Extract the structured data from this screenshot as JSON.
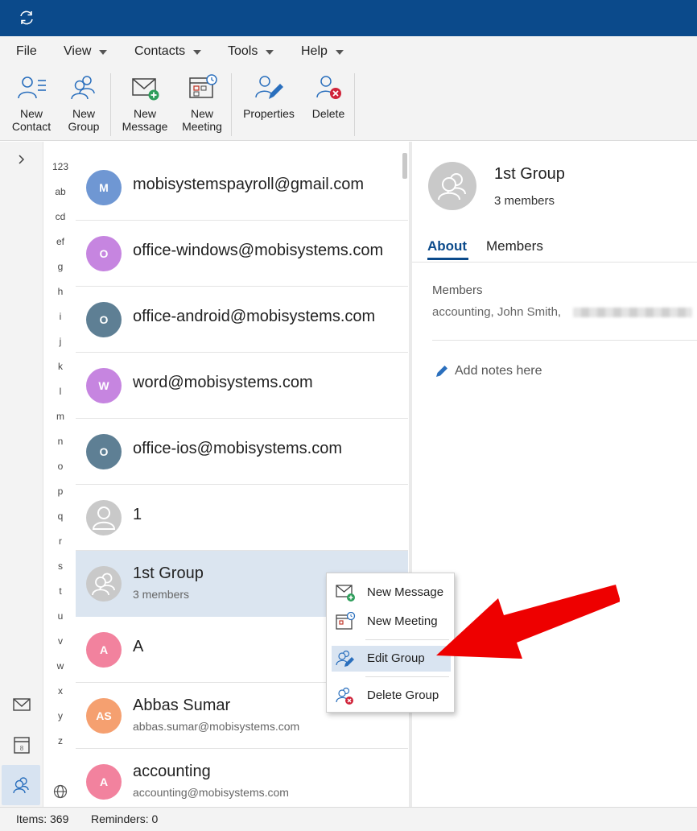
{
  "menu": {
    "file": "File",
    "view": "View",
    "contacts": "Contacts",
    "tools": "Tools",
    "help": "Help"
  },
  "ribbon": {
    "new_contact": [
      "New",
      "Contact"
    ],
    "new_group": [
      "New",
      "Group"
    ],
    "new_message": [
      "New",
      "Message"
    ],
    "new_meeting": [
      "New",
      "Meeting"
    ],
    "properties": "Properties",
    "delete": "Delete"
  },
  "alphabet": [
    "123",
    "ab",
    "cd",
    "ef",
    "g",
    "h",
    "i",
    "j",
    "k",
    "l",
    "m",
    "n",
    "o",
    "p",
    "q",
    "r",
    "s",
    "t",
    "u",
    "v",
    "w",
    "x",
    "y",
    "z"
  ],
  "contacts": [
    {
      "initials": "M",
      "name": "mobisystemspayroll@gmail.com",
      "sub": "",
      "color": "#6f97d3"
    },
    {
      "initials": "O",
      "name": "office-windows@mobisystems.com",
      "sub": "",
      "color": "#c685e0"
    },
    {
      "initials": "O",
      "name": "office-android@mobisystems.com",
      "sub": "",
      "color": "#5e7f94"
    },
    {
      "initials": "W",
      "name": "word@mobisystems.com",
      "sub": "",
      "color": "#c685e0"
    },
    {
      "initials": "O",
      "name": "office-ios@mobisystems.com",
      "sub": "",
      "color": "#5e7f94"
    },
    {
      "initials": "",
      "name": "1",
      "sub": "",
      "color": "#c9c9c9"
    },
    {
      "initials": "",
      "name": "1st Group",
      "sub": "3 members",
      "color": "#c9c9c9"
    },
    {
      "initials": "A",
      "name": "A",
      "sub": "",
      "color": "#f2829e"
    },
    {
      "initials": "AS",
      "name": "Abbas Sumar",
      "sub": "abbas.sumar@mobisystems.com",
      "color": "#f5a070"
    },
    {
      "initials": "A",
      "name": "accounting",
      "sub": "accounting@mobisystems.com",
      "color": "#f2829e"
    }
  ],
  "detail": {
    "title": "1st Group",
    "count": "3 members",
    "tabs": [
      "About",
      "Members"
    ],
    "members_label": "Members",
    "members_list": "accounting,  John Smith,",
    "notes": "Add notes here"
  },
  "context_menu": {
    "new_message": "New Message",
    "new_meeting": "New Meeting",
    "edit_group": "Edit Group",
    "delete_group": "Delete Group"
  },
  "status": {
    "items": "Items: 369",
    "reminders": "Reminders: 0"
  },
  "colors": {
    "title_bar": "#0b4a8b",
    "accent": "#0b4a8b",
    "arrow": "#ee0000",
    "selection": "#dbe5f0"
  }
}
